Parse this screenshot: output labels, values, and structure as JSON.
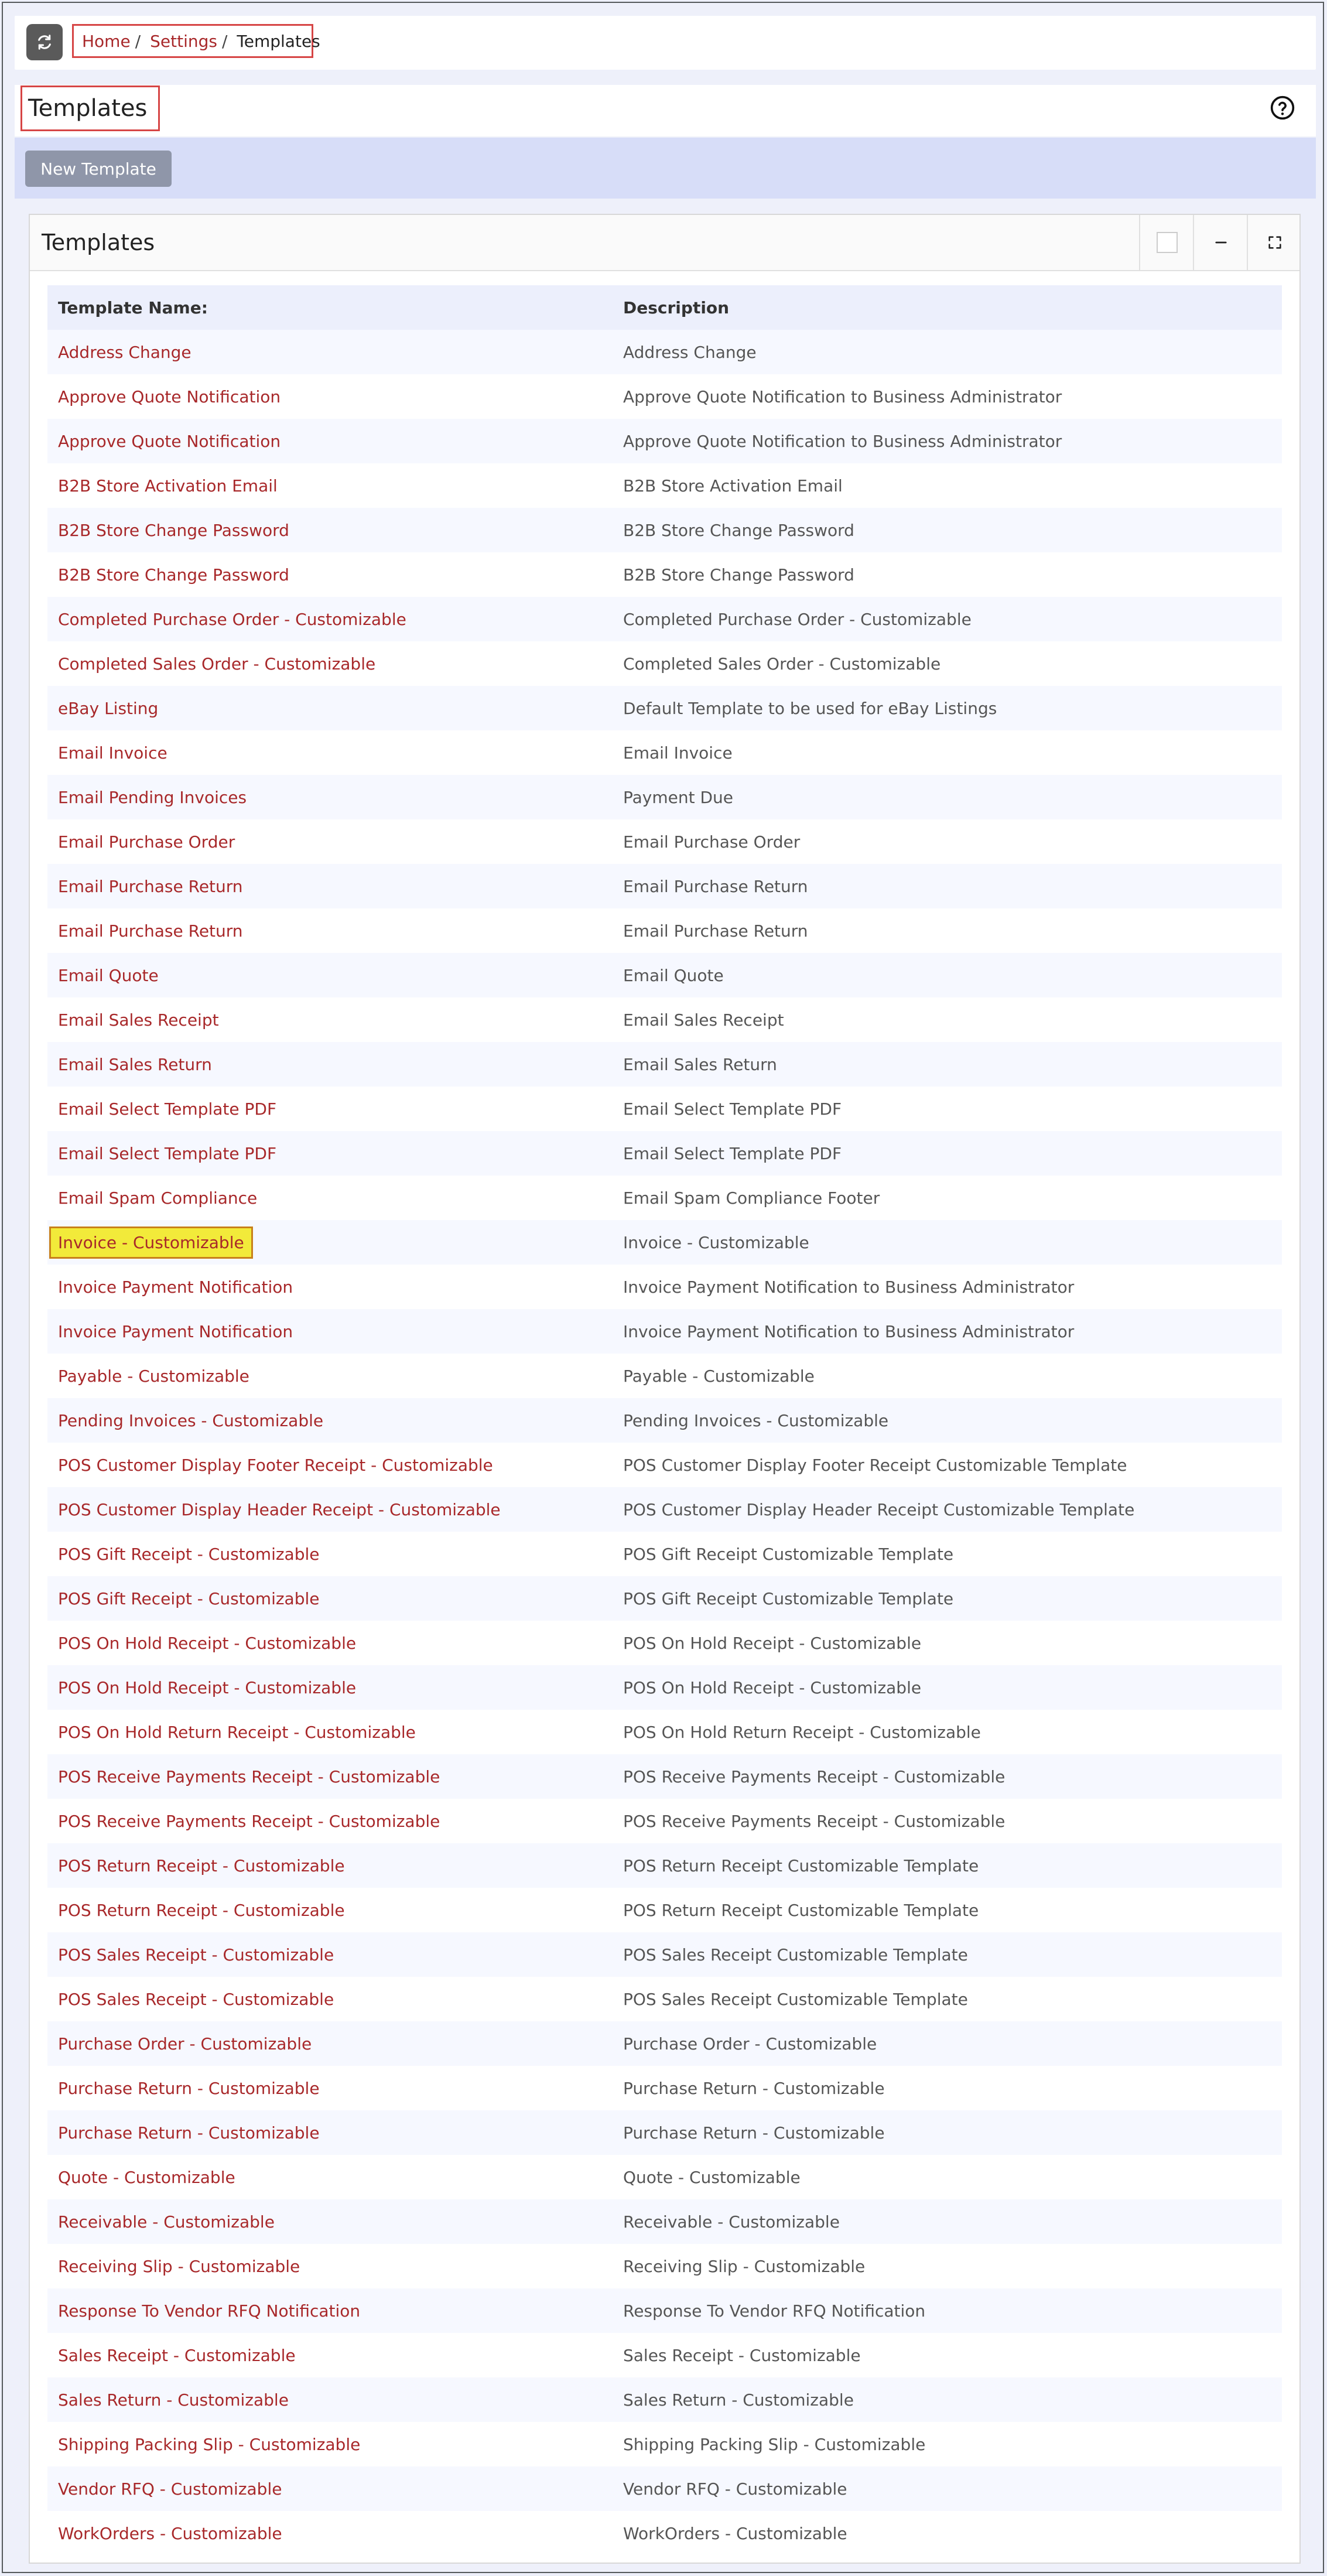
{
  "breadcrumb": {
    "home": "Home",
    "settings": "Settings",
    "current": "Templates"
  },
  "page": {
    "title": "Templates"
  },
  "actions": {
    "new_template": "New Template"
  },
  "panel": {
    "title": "Templates"
  },
  "table": {
    "headers": {
      "name": "Template Name:",
      "description": "Description"
    },
    "rows": [
      {
        "name": "Address Change",
        "description": "Address Change"
      },
      {
        "name": "Approve Quote Notification",
        "description": "Approve Quote Notification to Business Administrator"
      },
      {
        "name": "Approve Quote Notification",
        "description": "Approve Quote Notification to Business Administrator"
      },
      {
        "name": "B2B Store Activation Email",
        "description": "B2B Store Activation Email"
      },
      {
        "name": "B2B Store Change Password",
        "description": "B2B Store Change Password"
      },
      {
        "name": "B2B Store Change Password",
        "description": "B2B Store Change Password"
      },
      {
        "name": "Completed Purchase Order - Customizable",
        "description": "Completed Purchase Order - Customizable"
      },
      {
        "name": "Completed Sales Order - Customizable",
        "description": "Completed Sales Order - Customizable"
      },
      {
        "name": "eBay Listing",
        "description": "Default Template to be used for eBay Listings"
      },
      {
        "name": "Email Invoice",
        "description": "Email Invoice"
      },
      {
        "name": "Email Pending Invoices",
        "description": "Payment Due"
      },
      {
        "name": "Email Purchase Order",
        "description": "Email Purchase Order"
      },
      {
        "name": "Email Purchase Return",
        "description": "Email Purchase Return"
      },
      {
        "name": "Email Purchase Return",
        "description": "Email Purchase Return"
      },
      {
        "name": "Email Quote",
        "description": "Email Quote"
      },
      {
        "name": "Email Sales Receipt",
        "description": "Email Sales Receipt"
      },
      {
        "name": "Email Sales Return",
        "description": "Email Sales Return"
      },
      {
        "name": "Email Select Template PDF",
        "description": "Email Select Template PDF"
      },
      {
        "name": "Email Select Template PDF",
        "description": "Email Select Template PDF"
      },
      {
        "name": "Email Spam Compliance",
        "description": "Email Spam Compliance Footer"
      },
      {
        "name": "Invoice - Customizable",
        "description": "Invoice - Customizable",
        "highlight": true
      },
      {
        "name": "Invoice Payment Notification",
        "description": "Invoice Payment Notification to Business Administrator"
      },
      {
        "name": "Invoice Payment Notification",
        "description": "Invoice Payment Notification to Business Administrator"
      },
      {
        "name": "Payable - Customizable",
        "description": "Payable - Customizable"
      },
      {
        "name": "Pending Invoices - Customizable",
        "description": "Pending Invoices - Customizable"
      },
      {
        "name": "POS Customer Display Footer Receipt - Customizable",
        "description": "POS Customer Display Footer Receipt Customizable Template"
      },
      {
        "name": "POS Customer Display Header Receipt - Customizable",
        "description": "POS Customer Display Header Receipt Customizable Template"
      },
      {
        "name": "POS Gift Receipt - Customizable",
        "description": "POS Gift Receipt Customizable Template"
      },
      {
        "name": "POS Gift Receipt - Customizable",
        "description": "POS Gift Receipt Customizable Template"
      },
      {
        "name": "POS On Hold Receipt - Customizable",
        "description": "POS On Hold Receipt - Customizable"
      },
      {
        "name": "POS On Hold Receipt - Customizable",
        "description": "POS On Hold Receipt - Customizable"
      },
      {
        "name": "POS On Hold Return Receipt - Customizable",
        "description": "POS On Hold Return Receipt - Customizable"
      },
      {
        "name": "POS Receive Payments Receipt - Customizable",
        "description": "POS Receive Payments Receipt - Customizable"
      },
      {
        "name": "POS Receive Payments Receipt - Customizable",
        "description": "POS Receive Payments Receipt - Customizable"
      },
      {
        "name": "POS Return Receipt - Customizable",
        "description": "POS Return Receipt Customizable Template"
      },
      {
        "name": "POS Return Receipt - Customizable",
        "description": "POS Return Receipt Customizable Template"
      },
      {
        "name": "POS Sales Receipt - Customizable",
        "description": "POS Sales Receipt Customizable Template"
      },
      {
        "name": "POS Sales Receipt - Customizable",
        "description": "POS Sales Receipt Customizable Template"
      },
      {
        "name": "Purchase Order - Customizable",
        "description": "Purchase Order - Customizable"
      },
      {
        "name": "Purchase Return - Customizable",
        "description": "Purchase Return - Customizable"
      },
      {
        "name": "Purchase Return - Customizable",
        "description": "Purchase Return - Customizable"
      },
      {
        "name": "Quote - Customizable",
        "description": "Quote - Customizable"
      },
      {
        "name": "Receivable - Customizable",
        "description": "Receivable - Customizable"
      },
      {
        "name": "Receiving Slip - Customizable",
        "description": "Receiving Slip - Customizable"
      },
      {
        "name": "Response To Vendor RFQ Notification",
        "description": "Response To Vendor RFQ Notification"
      },
      {
        "name": "Sales Receipt - Customizable",
        "description": "Sales Receipt - Customizable"
      },
      {
        "name": "Sales Return - Customizable",
        "description": "Sales Return - Customizable"
      },
      {
        "name": "Shipping Packing Slip - Customizable",
        "description": "Shipping Packing Slip - Customizable"
      },
      {
        "name": "Vendor RFQ - Customizable",
        "description": "Vendor RFQ - Customizable"
      },
      {
        "name": "WorkOrders - Customizable",
        "description": "WorkOrders - Customizable"
      }
    ]
  },
  "icons": {
    "refresh": "refresh-icon",
    "help": "help-circle-icon",
    "select": "checkbox-icon",
    "minimize": "minimize-icon",
    "expand": "expand-icon"
  },
  "colors": {
    "link": "#a8282a",
    "highlight_bg": "#f2ea3a",
    "action_bar": "#d7ddf8",
    "button": "#8f96a9",
    "annotation": "#d64545"
  }
}
